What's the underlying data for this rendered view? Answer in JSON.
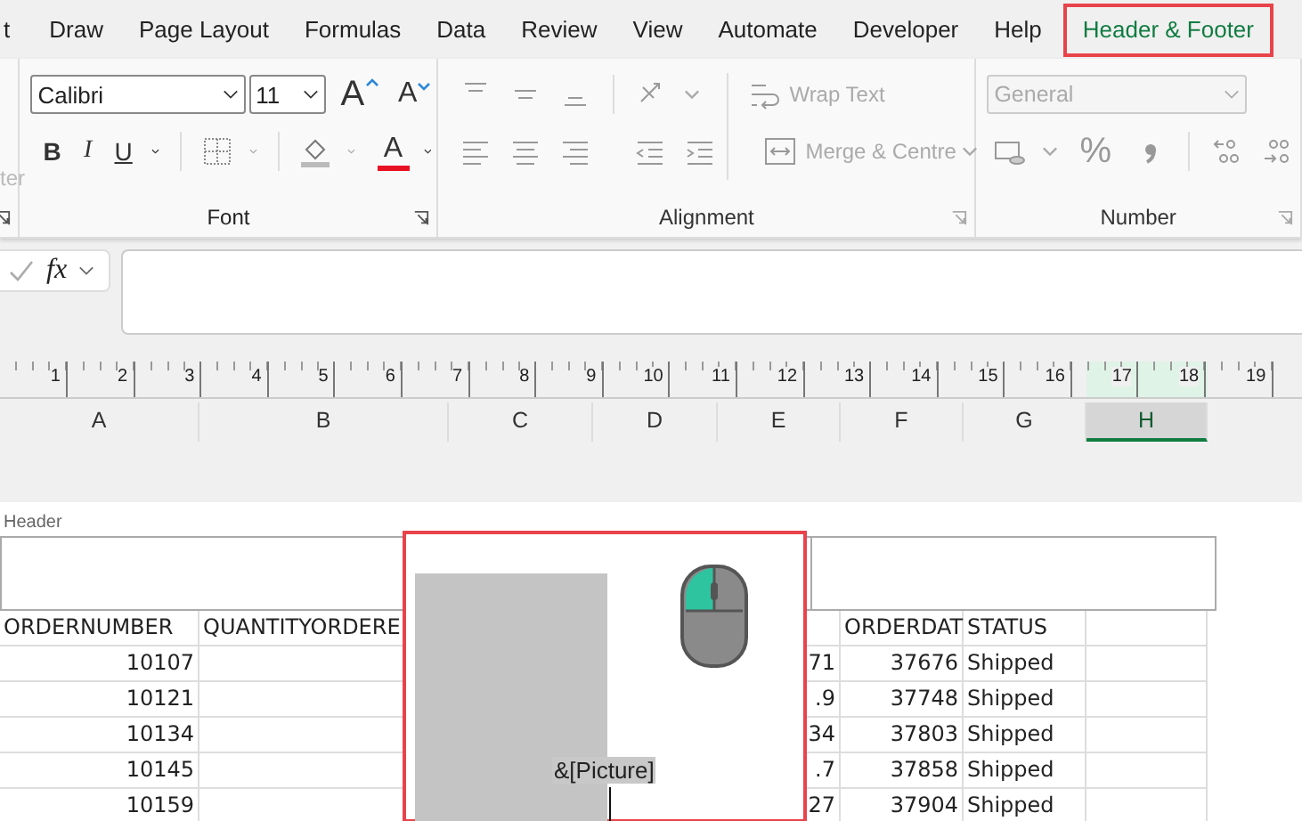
{
  "ribbon_tabs": [
    {
      "label": "t",
      "selected": false
    },
    {
      "label": "Draw",
      "selected": false
    },
    {
      "label": "Page Layout",
      "selected": false
    },
    {
      "label": "Formulas",
      "selected": false
    },
    {
      "label": "Data",
      "selected": false
    },
    {
      "label": "Review",
      "selected": false
    },
    {
      "label": "View",
      "selected": false
    },
    {
      "label": "Automate",
      "selected": false
    },
    {
      "label": "Developer",
      "selected": false
    },
    {
      "label": "Help",
      "selected": false
    },
    {
      "label": "Header & Footer",
      "selected": true
    }
  ],
  "ribbon": {
    "partial_group": {
      "label": "ter"
    },
    "font_group": {
      "label": "Font",
      "disabled": false,
      "font_name": "Calibri",
      "font_size": "11",
      "grow_font": "A",
      "shrink_font": "A",
      "style_buttons": [
        {
          "label": "B",
          "kind": "bold"
        },
        {
          "label": "I",
          "kind": "italic"
        },
        {
          "label": "U",
          "kind": "underline"
        }
      ],
      "font_color": "A"
    },
    "alignment_group": {
      "label": "Alignment",
      "disabled": true,
      "wrap_text": "Wrap Text",
      "merge": "Merge & Centre"
    },
    "number_group": {
      "label": "Number",
      "disabled": true,
      "format": "General",
      "percent": "%"
    }
  },
  "formula_bar": {
    "function_symbol": "fx"
  },
  "ruler": [
    "1",
    "2",
    "3",
    "4",
    "5",
    "6",
    "7",
    "8",
    "9",
    "10",
    "11",
    "12",
    "13",
    "14",
    "15",
    "16",
    "17",
    "18",
    "19"
  ],
  "columns": [
    {
      "label": "A",
      "selected": false
    },
    {
      "label": "B",
      "selected": false
    },
    {
      "label": "C",
      "selected": false
    },
    {
      "label": "D",
      "selected": false
    },
    {
      "label": "E",
      "selected": false
    },
    {
      "label": "F",
      "selected": false
    },
    {
      "label": "G",
      "selected": false
    },
    {
      "label": "H",
      "selected": true
    }
  ],
  "header_area": {
    "label": "Header"
  },
  "table": {
    "rows": [
      {
        "kind": "header",
        "a": "ORDERNUMBER",
        "b": "QUANTITYORDERE",
        "f": "ORDERDAT",
        "g": "STATUS"
      },
      {
        "kind": "data",
        "a": "10107",
        "e": "71",
        "f": "37676",
        "g": "Shipped"
      },
      {
        "kind": "data",
        "a": "10121",
        "e": ".9",
        "f": "37748",
        "g": "Shipped"
      },
      {
        "kind": "data",
        "a": "10134",
        "e": "34",
        "f": "37803",
        "g": "Shipped"
      },
      {
        "kind": "data",
        "a": "10145",
        "e": ".7",
        "f": "37858",
        "g": "Shipped"
      },
      {
        "kind": "data",
        "a": "10159",
        "e": "27",
        "f": "37904",
        "g": "Shipped"
      }
    ]
  },
  "picture_popup": {
    "code": "&[Picture]",
    "selected": true
  }
}
